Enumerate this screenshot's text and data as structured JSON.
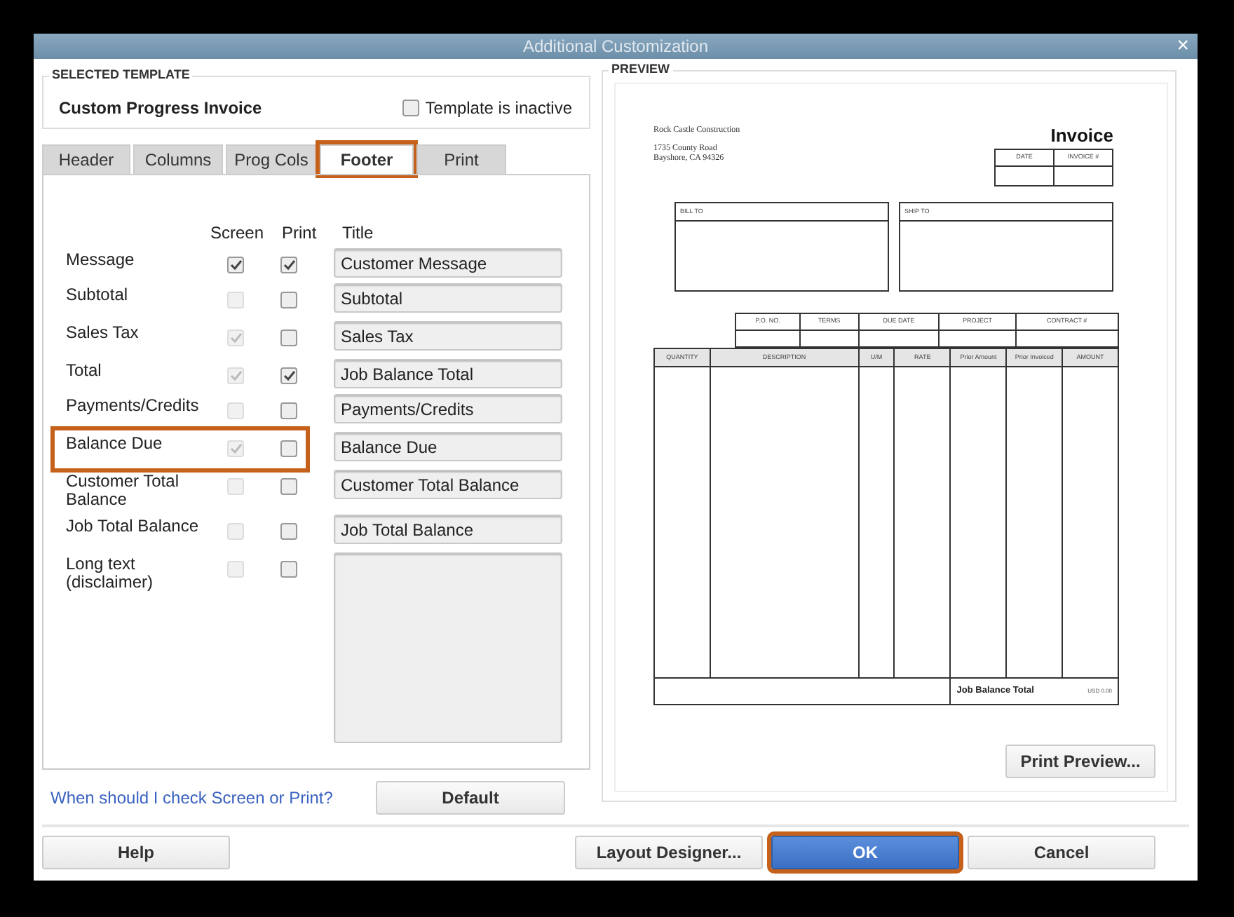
{
  "window": {
    "title": "Additional Customization",
    "close": "×"
  },
  "selected_template": {
    "legend": "SELECTED TEMPLATE",
    "name": "Custom Progress Invoice",
    "inactive_label": "Template is inactive",
    "inactive": false
  },
  "tabs": [
    {
      "label": "Header",
      "selected": false,
      "highlighted": false
    },
    {
      "label": "Columns",
      "selected": false,
      "highlighted": false
    },
    {
      "label": "Prog Cols",
      "selected": false,
      "highlighted": false
    },
    {
      "label": "Footer",
      "selected": true,
      "highlighted": true
    },
    {
      "label": "Print",
      "selected": false,
      "highlighted": false
    }
  ],
  "footer": {
    "columns": [
      "Screen",
      "Print",
      "Title"
    ],
    "rows": [
      {
        "label": "Message",
        "screen": {
          "checked": true,
          "disabled": false
        },
        "print": {
          "checked": true
        },
        "kind": "field",
        "title": "Customer Message",
        "highlighted": false
      },
      {
        "label": "Subtotal",
        "screen": {
          "checked": false,
          "disabled": true
        },
        "print": {
          "checked": false
        },
        "kind": "field",
        "title": "Subtotal",
        "highlighted": false
      },
      {
        "label": "Sales Tax",
        "screen": {
          "checked": true,
          "disabled": true
        },
        "print": {
          "checked": false
        },
        "kind": "field",
        "title": "Sales Tax",
        "highlighted": false
      },
      {
        "label": "Total",
        "screen": {
          "checked": true,
          "disabled": true
        },
        "print": {
          "checked": true
        },
        "kind": "field",
        "title": "Job Balance Total",
        "highlighted": false
      },
      {
        "label": "Payments/Credits",
        "screen": {
          "checked": false,
          "disabled": true
        },
        "print": {
          "checked": false
        },
        "kind": "field",
        "title": "Payments/Credits",
        "highlighted": false
      },
      {
        "label": "Balance Due",
        "screen": {
          "checked": true,
          "disabled": true
        },
        "print": {
          "checked": false
        },
        "kind": "field",
        "title": "Balance Due",
        "highlighted": true
      },
      {
        "label": "Customer Total Balance",
        "screen": {
          "checked": false,
          "disabled": true
        },
        "print": {
          "checked": false
        },
        "kind": "field",
        "title": "Customer Total Balance",
        "highlighted": false
      },
      {
        "label": "Job Total Balance",
        "screen": {
          "checked": false,
          "disabled": true
        },
        "print": {
          "checked": false
        },
        "kind": "field",
        "title": "Job Total Balance",
        "highlighted": false
      },
      {
        "label": "Long text (disclaimer)",
        "screen": {
          "checked": false,
          "disabled": true
        },
        "print": {
          "checked": false
        },
        "kind": "textarea",
        "highlighted": false
      }
    ],
    "help_link": "When should I check Screen or Print?",
    "default_button": "Default"
  },
  "preview": {
    "legend": "PREVIEW",
    "company": "Rock Castle Construction",
    "address": [
      "1735 County Road",
      "Bayshore, CA 94326"
    ],
    "title": "Invoice",
    "header_cells": [
      "DATE",
      "INVOICE #"
    ],
    "bill_to": "BILL TO",
    "ship_to": "SHIP TO",
    "info_columns": [
      "P.O. NO.",
      "TERMS",
      "DUE DATE",
      "PROJECT",
      "CONTRACT #"
    ],
    "item_columns": [
      "QUANTITY",
      "DESCRIPTION",
      "U/M",
      "RATE",
      "Prior Amount",
      "Prior Invoiced",
      "AMOUNT"
    ],
    "total_label": "Job Balance Total",
    "total_value": "USD 0.00",
    "print_preview_button": "Print Preview..."
  },
  "buttons": [
    {
      "label": "Help",
      "kind": "plain",
      "highlighted": false
    },
    {
      "label": "Layout Designer...",
      "kind": "plain",
      "highlighted": false
    },
    {
      "label": "OK",
      "kind": "primary",
      "highlighted": true
    },
    {
      "label": "Cancel",
      "kind": "plain",
      "highlighted": false
    }
  ]
}
